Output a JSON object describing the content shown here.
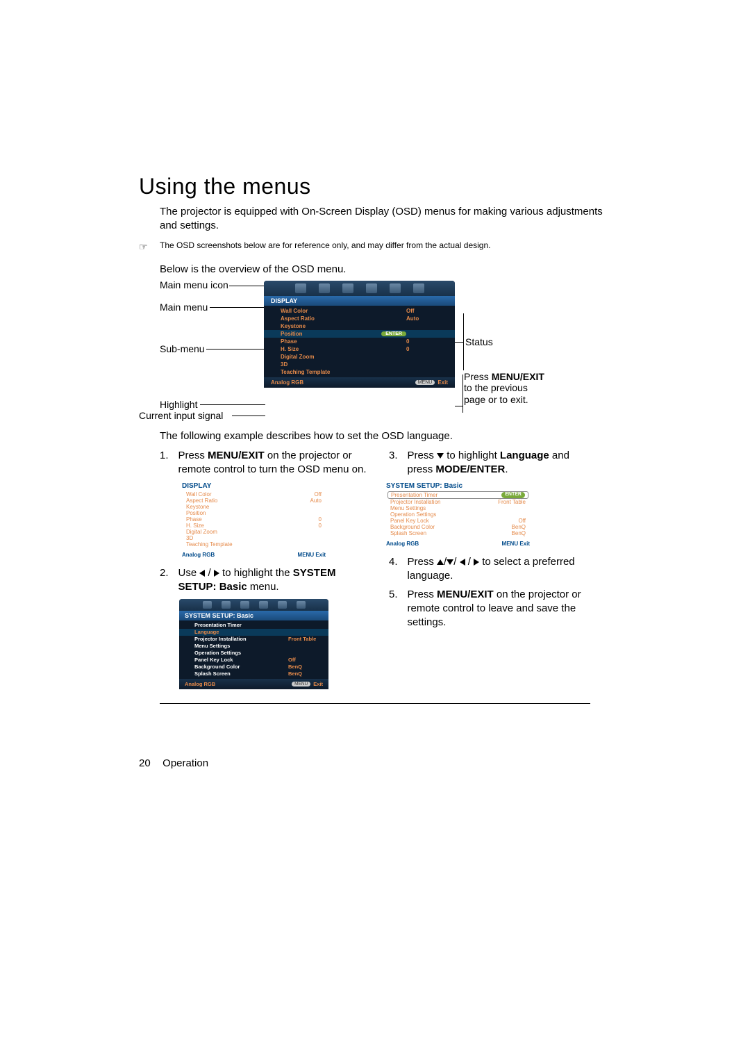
{
  "heading": "Using the menus",
  "intro": "The projector is equipped with On-Screen Display (OSD) menus for making various adjustments and settings.",
  "note": "The OSD screenshots below are for reference only, and may differ from the actual design.",
  "overview": "Below is the overview of the OSD menu.",
  "labels": {
    "mainMenuIcon": "Main menu icon",
    "mainMenu": "Main menu",
    "subMenu": "Sub-menu",
    "highlight": "Highlight",
    "currentInput": "Current input signal",
    "status": "Status",
    "pressMenu": "Press ",
    "menuExit": "MENU/EXIT",
    "menuExitTail": " to the previous page or to exit."
  },
  "osdMain": {
    "title": "DISPLAY",
    "rows": [
      {
        "label": "Wall Color",
        "value": "Off"
      },
      {
        "label": "Aspect Ratio",
        "value": "Auto"
      },
      {
        "label": "Keystone",
        "value": ""
      },
      {
        "label": "Position",
        "value": "",
        "enter": "ENTER"
      },
      {
        "label": "Phase",
        "value": "0"
      },
      {
        "label": "H. Size",
        "value": "0"
      },
      {
        "label": "Digital Zoom",
        "value": ""
      },
      {
        "label": "3D",
        "value": ""
      },
      {
        "label": "Teaching Template",
        "value": ""
      }
    ],
    "footSignal": "Analog RGB",
    "footMenu": "MENU",
    "footExit": "Exit"
  },
  "afterDiagram": "The following example describes how to set the OSD language.",
  "step1": {
    "num": "1.",
    "pre": "Press ",
    "bold": "MENU/EXIT",
    "post": " on the projector or remote control to turn the OSD menu on."
  },
  "mini1": {
    "title": "DISPLAY",
    "rows": [
      {
        "l": "Wall Color",
        "v": "Off"
      },
      {
        "l": "Aspect Ratio",
        "v": "Auto"
      },
      {
        "l": "Keystone",
        "v": ""
      },
      {
        "l": "Position",
        "v": ""
      },
      {
        "l": "Phase",
        "v": "0"
      },
      {
        "l": "H. Size",
        "v": "0"
      },
      {
        "l": "Digital Zoom",
        "v": ""
      },
      {
        "l": "3D",
        "v": ""
      },
      {
        "l": "Teaching Template",
        "v": ""
      }
    ],
    "footSignal": "Analog RGB",
    "footRight": "MENU  Exit"
  },
  "step2": {
    "num": "2.",
    "pre": "Use ",
    "mid": " to highlight the ",
    "bold": "SYSTEM SETUP: Basic",
    "post": " menu."
  },
  "mini2": {
    "title": "SYSTEM SETUP: Basic",
    "rows": [
      {
        "l": "Presentation Timer",
        "v": ""
      },
      {
        "l": "Language",
        "v": "",
        "sel": true
      },
      {
        "l": "Projector Installation",
        "v": "Front Table"
      },
      {
        "l": "Menu Settings",
        "v": ""
      },
      {
        "l": "Operation Settings",
        "v": ""
      },
      {
        "l": "Panel Key Lock",
        "v": "Off"
      },
      {
        "l": "Background Color",
        "v": "BenQ"
      },
      {
        "l": "Splash Screen",
        "v": "BenQ"
      }
    ],
    "footSignal": "Analog RGB",
    "footMenu": "MENU",
    "footExit": "Exit"
  },
  "step3": {
    "num": "3.",
    "pre": "Press ",
    "mid": " to highlight ",
    "bold": "Language",
    "post": " and press ",
    "bold2": "MODE/ENTER",
    "end": "."
  },
  "mini3": {
    "title": "SYSTEM SETUP: Basic",
    "rows": [
      {
        "l": "Presentation Timer",
        "v": "",
        "hl": true,
        "enter": "ENTER"
      },
      {
        "l": "Projector Installation",
        "v": "Front Table"
      },
      {
        "l": "Menu Settings",
        "v": ""
      },
      {
        "l": "Operation Settings",
        "v": ""
      },
      {
        "l": "Panel Key Lock",
        "v": "Off"
      },
      {
        "l": "Background Color",
        "v": "BenQ"
      },
      {
        "l": "Splash Screen",
        "v": "BenQ"
      }
    ],
    "footSignal": "Analog RGB",
    "footRight": "MENU  Exit"
  },
  "step4": {
    "num": "4.",
    "pre": "Press ",
    "post": " to select a preferred language."
  },
  "step5": {
    "num": "5.",
    "pre": "Press ",
    "bold": "MENU/EXIT",
    "post": " on the projector or remote control to leave and save the settings."
  },
  "footer": {
    "page": "20",
    "section": "Operation"
  }
}
